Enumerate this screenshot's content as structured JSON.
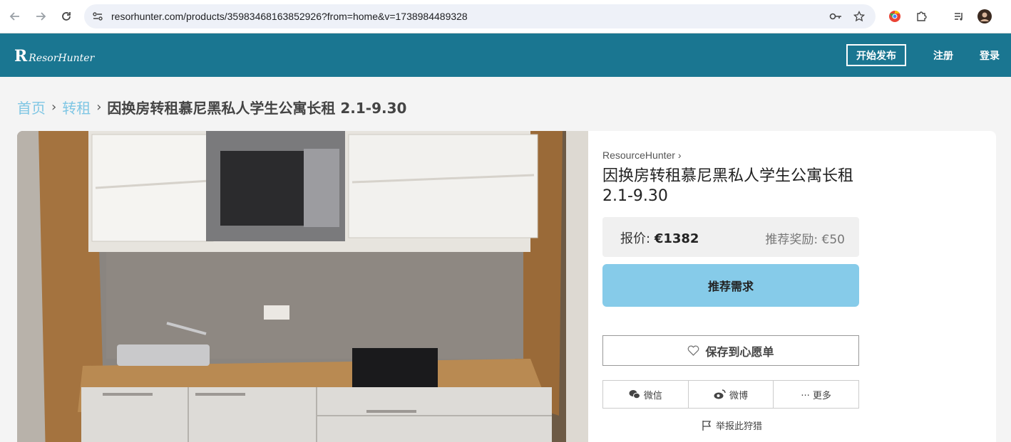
{
  "browser": {
    "url": "resorhunter.com/products/35983468163852926?from=home&v=1738984489328"
  },
  "header": {
    "logo_letter": "R",
    "logo_text": "ResorHunter",
    "publish_label": "开始发布",
    "register_label": "注册",
    "login_label": "登录",
    "brand_color": "#1a7691"
  },
  "breadcrumb": {
    "home": "首页",
    "category": "转租",
    "current": "因换房转租慕尼黑私人学生公寓长租 2.1-9.30"
  },
  "product": {
    "seller": "ResourceHunter",
    "title": "因换房转租慕尼黑私人学生公寓长租 2.1-9.30",
    "price_label": "报价:",
    "price_value": "€1382",
    "reward": "推荐奖励: €50",
    "recommend_label": "推荐需求",
    "wishlist_label": "保存到心愿单",
    "share": {
      "wechat": "微信",
      "weibo": "微博",
      "more": "··· 更多"
    },
    "report_label": "举报此狩猎",
    "image_alt": "kitchen-photo"
  }
}
